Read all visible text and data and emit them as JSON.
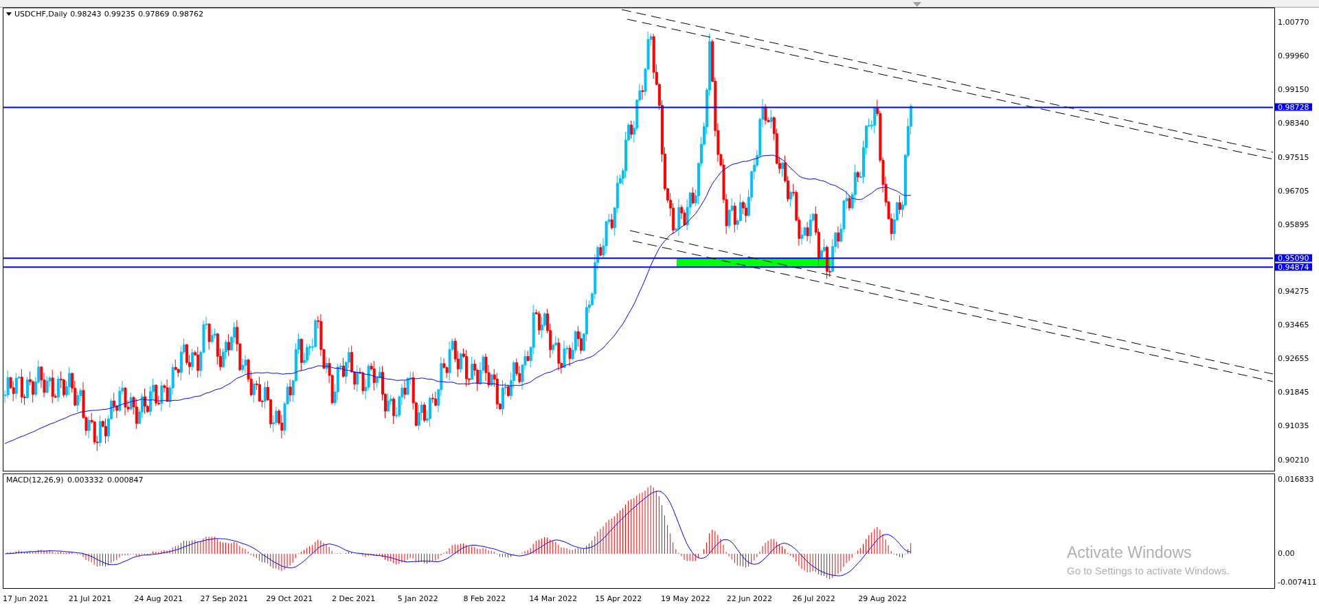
{
  "chart": {
    "symbol": "USDCHF,Daily",
    "ohlc": [
      "0.98243",
      "0.99235",
      "0.97869",
      "0.98762"
    ],
    "price_ticks": [
      "1.00770",
      "0.99960",
      "0.99150",
      "0.98340",
      "0.97515",
      "0.96705",
      "0.95895",
      "0.94275",
      "0.93465",
      "0.92655",
      "0.91845",
      "0.91035",
      "0.90210"
    ]
  },
  "levels": [
    {
      "label": "0.98728"
    },
    {
      "label": "0.95090"
    },
    {
      "label": "0.94874"
    }
  ],
  "macd": {
    "title": "MACD(12,26,9) 0.003332 0.000847",
    "ticks": [
      "0.016833",
      "0.00",
      "-0.007411"
    ]
  },
  "date_axis": [
    "17 Jun 2021",
    "21 Jul 2021",
    "24 Aug 2021",
    "27 Sep 2021",
    "29 Oct 2021",
    "2 Dec 2021",
    "5 Jan 2022",
    "8 Feb 2022",
    "14 Mar 2022",
    "15 Apr 2022",
    "19 May 2022",
    "22 Jun 2022",
    "26 Jul 2022",
    "29 Aug 2022"
  ],
  "os_overlay": {
    "title": "Activate Windows",
    "subtitle": "Go to Settings to activate Windows."
  }
}
